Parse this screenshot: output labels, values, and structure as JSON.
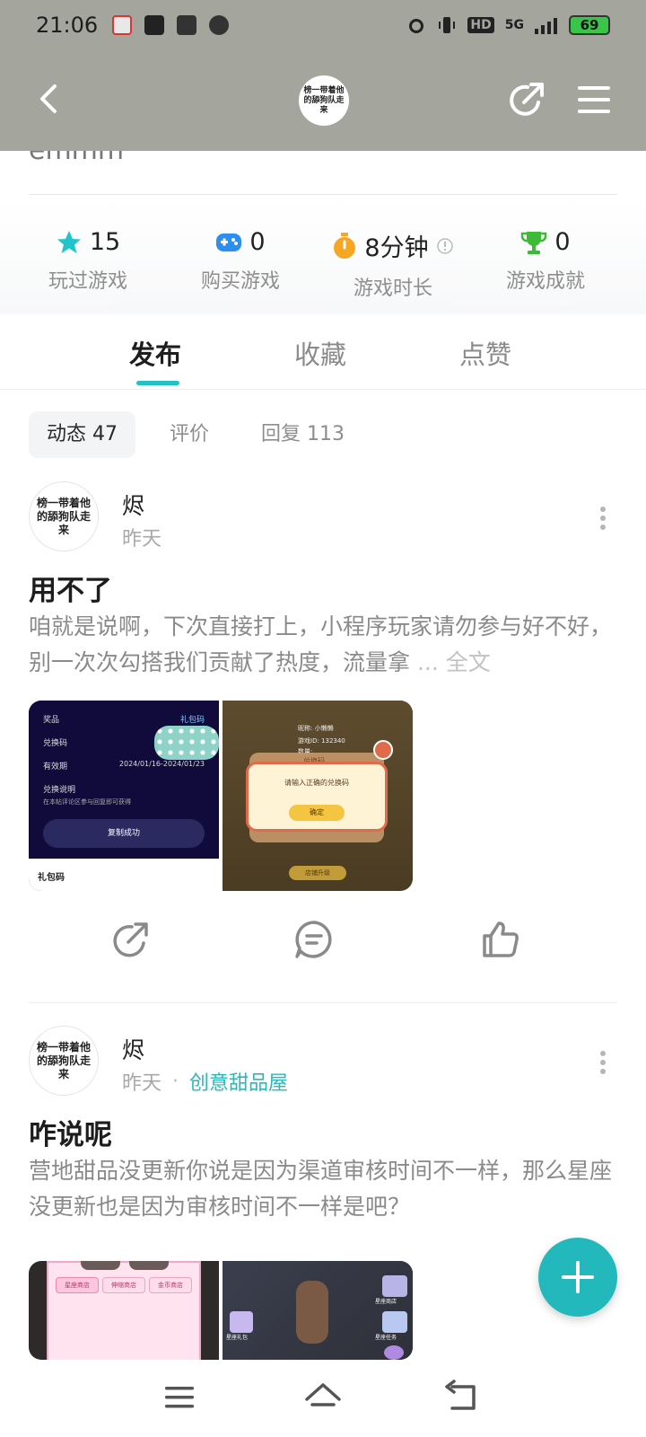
{
  "status_bar": {
    "time": "21:06",
    "network": "5G",
    "hd": "HD",
    "battery": "69",
    "app_icons": [
      "map-pin-icon",
      "dashen-app-icon",
      "shopping-bag-icon",
      "wechat-icon"
    ]
  },
  "header": {
    "avatar_text": "榜一带着他的舔狗队走来",
    "back_icon": "back-arrow-icon",
    "share_icon": "share-icon",
    "menu_icon": "hamburger-menu-icon"
  },
  "profile": {
    "cut_text": "emmm"
  },
  "stats": [
    {
      "value": "15",
      "label": "玩过游戏",
      "icon": "star-icon",
      "color": "#22c4cc"
    },
    {
      "value": "0",
      "label": "购买游戏",
      "icon": "gamepad-icon",
      "color": "#2b8ff0"
    },
    {
      "value": "8分钟",
      "label": "游戏时长",
      "icon": "stopwatch-icon",
      "color": "#f5a623"
    },
    {
      "value": "0",
      "label": "游戏成就",
      "icon": "trophy-icon",
      "color": "#3fb938"
    }
  ],
  "tabs": [
    {
      "label": "发布",
      "active": true
    },
    {
      "label": "收藏",
      "active": false
    },
    {
      "label": "点赞",
      "active": false
    }
  ],
  "subtabs": [
    {
      "label": "动态 47",
      "active": true
    },
    {
      "label": "评价",
      "active": false
    },
    {
      "label": "回复 113",
      "active": false
    }
  ],
  "posts": [
    {
      "avatar_text": "榜一带着他的舔狗队走来",
      "username": "烬",
      "time": "昨天",
      "topic": "",
      "title": "用不了",
      "body": "咱就是说啊，下次直接打上，小程序玩家请勿参与好不好，别一次次勾搭我们贡献了热度，流量拿",
      "ellipsis": "... 全文",
      "images": {
        "left": {
          "rows": [
            {
              "label": "奖品",
              "value": "礼包码"
            },
            {
              "label": "兑换码",
              "value": ""
            },
            {
              "label": "有效期",
              "value": "2024/01/16-2024/01/23"
            },
            {
              "label": "兑换说明",
              "value": ""
            }
          ],
          "note": "在本帖评论区参与回复即可获得",
          "button": "复制成功",
          "caption": "礼包码"
        },
        "right": {
          "name_line": "昵称: 小懒懒",
          "id_line": "游戏ID: 132340",
          "amount_label": "数量:",
          "dialog_title": "兑换码",
          "dialog_text": "请输入正确的兑换码",
          "confirm": "确定",
          "bottom_btn": "店铺升级"
        }
      }
    },
    {
      "avatar_text": "榜一带着他的舔狗队走来",
      "username": "烬",
      "time": "昨天",
      "topic": "创意甜品屋",
      "title": "咋说呢",
      "body": "营地甜品没更新你说是因为渠道审核时间不一样，那么星座没更新也是因为审核时间不一样是吧？",
      "ellipsis": "",
      "images": {
        "left": {
          "tags": [
            "星座商店",
            "伸缩商店",
            "金币商店"
          ]
        },
        "right": {
          "tags": [
            "星座商店",
            "星座礼包",
            "星座任务"
          ]
        }
      }
    }
  ],
  "actions": [
    "share-icon",
    "comment-icon",
    "like-icon"
  ],
  "fab": {
    "icon": "plus-icon",
    "color": "#22b8bc"
  },
  "nav_bar": [
    "menu-icon",
    "home-icon",
    "back-icon"
  ]
}
